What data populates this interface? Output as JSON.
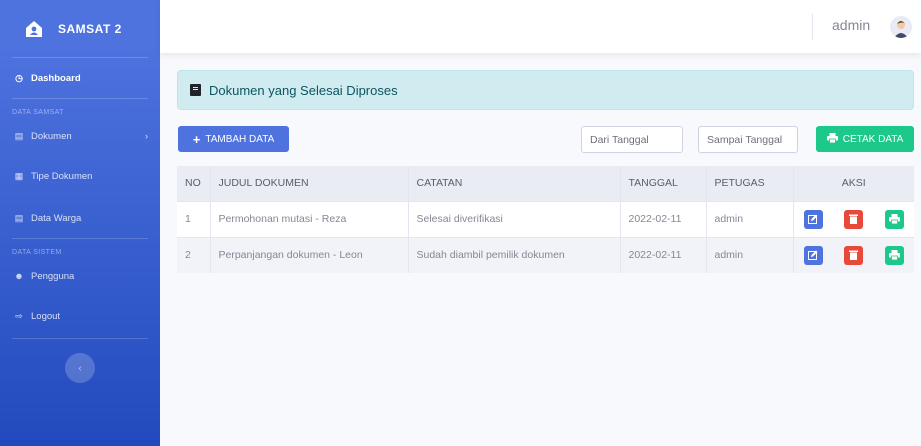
{
  "sidebar": {
    "brand": "SAMSAT 2",
    "dashboard": "Dashboard",
    "heading_samsat": "DATA SAMSAT",
    "dokumen": "Dokumen",
    "tipe_dokumen": "Tipe Dokumen",
    "data_warga": "Data Warga",
    "heading_sistem": "DATA SISTEM",
    "pengguna": "Pengguna",
    "logout": "Logout"
  },
  "topbar": {
    "user": "admin"
  },
  "page": {
    "alert": "Dokumen yang Selesai Diproses",
    "add_button": "TAMBAH DATA",
    "from_placeholder": "Dari Tanggal",
    "to_placeholder": "Sampai Tanggal",
    "print_button": "CETAK DATA"
  },
  "table": {
    "headers": [
      "NO",
      "JUDUL DOKUMEN",
      "CATATAN",
      "TANGGAL",
      "PETUGAS",
      "AKSI"
    ],
    "rows": [
      [
        "1",
        "Permohonan mutasi - Reza",
        "Selesai diverifikasi",
        "2022-02-11",
        "admin"
      ],
      [
        "2",
        "Perpanjangan dokumen - Leon",
        "Sudah diambil pemilik dokumen",
        "2022-02-11",
        "admin"
      ]
    ]
  },
  "colors": {
    "primary": "#4e73df",
    "success": "#1cc88a",
    "danger": "#e74a3b",
    "info_bg": "#d1ecf1"
  }
}
